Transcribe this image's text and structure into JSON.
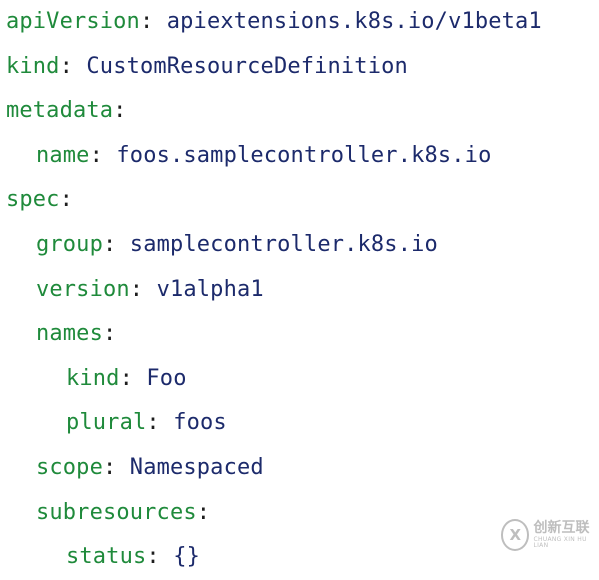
{
  "yaml": {
    "apiVersion": {
      "key": "apiVersion",
      "value": "apiextensions.k8s.io/v1beta1"
    },
    "kind": {
      "key": "kind",
      "value": "CustomResourceDefinition"
    },
    "metadata": {
      "key": "metadata",
      "name": {
        "key": "name",
        "value": "foos.samplecontroller.k8s.io"
      }
    },
    "spec": {
      "key": "spec",
      "group": {
        "key": "group",
        "value": "samplecontroller.k8s.io"
      },
      "version": {
        "key": "version",
        "value": "v1alpha1"
      },
      "names": {
        "key": "names",
        "kind": {
          "key": "kind",
          "value": "Foo"
        },
        "plural": {
          "key": "plural",
          "value": "foos"
        }
      },
      "scope": {
        "key": "scope",
        "value": "Namespaced"
      },
      "subresources": {
        "key": "subresources",
        "status": {
          "key": "status",
          "value": "{}"
        }
      }
    }
  },
  "punctuation": {
    "colon": ":"
  },
  "watermark": {
    "logo_glyph": "X",
    "cn_text": "创新互联",
    "en_text": "CHUANG XIN HU LIAN"
  },
  "colors": {
    "key": "#1f8a3b",
    "value": "#1c2a6b",
    "punctuation": "#1d1d1d",
    "background": "#ffffff"
  }
}
